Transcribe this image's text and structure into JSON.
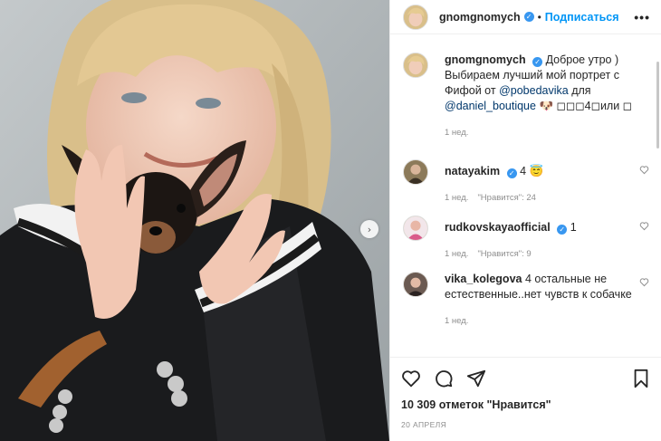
{
  "post": {
    "username": "gnomgnomych",
    "follow_label": "Подписаться",
    "more_label": "•••",
    "caption_text": "Доброе утро ) Выбираем лучший мой портрет с Фифой от",
    "mention_1": "@pobedavika",
    "caption_mid": "для",
    "mention_2": "@daniel_boutique",
    "caption_end": "🐶 ◻◻◻4◻или ◻",
    "caption_time": "1 нед."
  },
  "comments": [
    {
      "user": "natayakim",
      "text": "4 😇",
      "time": "1 нед.",
      "likes": "\"Нравится\": 24"
    },
    {
      "user": "rudkovskayaofficial",
      "text": "1",
      "time": "1 нед.",
      "likes": "\"Нравится\": 9"
    },
    {
      "user": "vika_kolegova",
      "text": "4 остальные не естественные..нет чувств к собачке",
      "time": "1 нед.",
      "likes": ""
    }
  ],
  "footer": {
    "likes_count": "10 309 отметок \"Нравится\"",
    "date": "20 АПРЕЛЯ"
  },
  "colors": {
    "link": "#00376b",
    "follow": "#0095f6",
    "verified": "#3897f0"
  },
  "icons": [
    "heart-icon",
    "comment-icon",
    "share-icon",
    "bookmark-icon",
    "next-arrow-icon",
    "more-icon"
  ]
}
